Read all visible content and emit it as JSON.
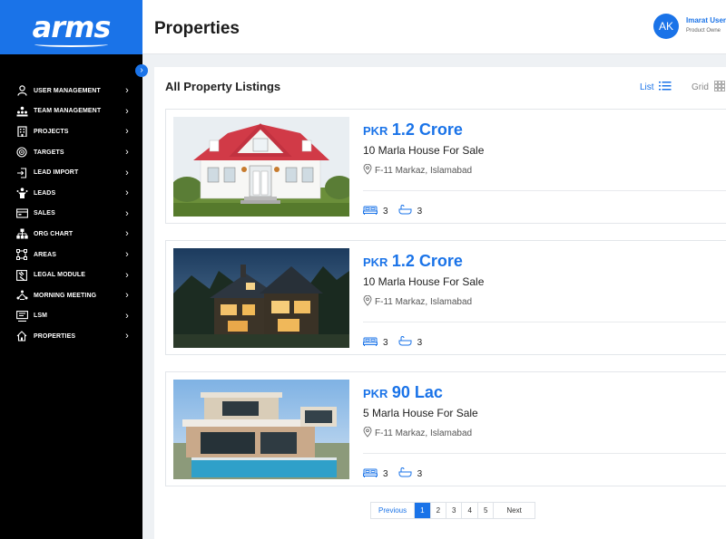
{
  "brand": {
    "logo_text": "arms"
  },
  "sidebar": {
    "items": [
      {
        "label": "USER MANAGEMENT",
        "icon": "user-icon"
      },
      {
        "label": "TEAM MANAGEMENT",
        "icon": "team-icon"
      },
      {
        "label": "PROJECTS",
        "icon": "building-icon"
      },
      {
        "label": "TARGETS",
        "icon": "target-icon"
      },
      {
        "label": "LEAD IMPORT",
        "icon": "import-icon"
      },
      {
        "label": "LEADS",
        "icon": "leads-icon"
      },
      {
        "label": "SALES",
        "icon": "sales-icon"
      },
      {
        "label": "ORG CHART",
        "icon": "org-chart-icon"
      },
      {
        "label": "AREAS",
        "icon": "areas-icon"
      },
      {
        "label": "LEGAL MODULE",
        "icon": "legal-icon"
      },
      {
        "label": "MORNING MEETING",
        "icon": "meeting-icon"
      },
      {
        "label": "LSM",
        "icon": "lsm-icon"
      },
      {
        "label": "PROPERTIES",
        "icon": "home-icon"
      }
    ]
  },
  "header": {
    "title": "Properties",
    "avatar_initials": "AK",
    "user_name": "Imarat User",
    "user_role": "Product Owne"
  },
  "main": {
    "title": "All Property Listings",
    "view_list": "List",
    "view_grid": "Grid"
  },
  "listings": [
    {
      "currency": "PKR",
      "price": "1.2 Crore",
      "title": "10 Marla House For Sale",
      "location": "F-11 Markaz, Islamabad",
      "beds": "3",
      "baths": "3"
    },
    {
      "currency": "PKR",
      "price": "1.2 Crore",
      "title": "10 Marla House For Sale",
      "location": "F-11 Markaz, Islamabad",
      "beds": "3",
      "baths": "3"
    },
    {
      "currency": "PKR",
      "price": "90 Lac",
      "title": "5 Marla House For Sale",
      "location": "F-11 Markaz, Islamabad",
      "beds": "3",
      "baths": "3"
    }
  ],
  "pagination": {
    "prev": "Previous",
    "pages": [
      "1",
      "2",
      "3",
      "4",
      "5"
    ],
    "current": "1",
    "next": "Next"
  },
  "colors": {
    "accent": "#1a73e8",
    "sidebar_bg": "#000000",
    "page_bg": "#eef1f4"
  }
}
